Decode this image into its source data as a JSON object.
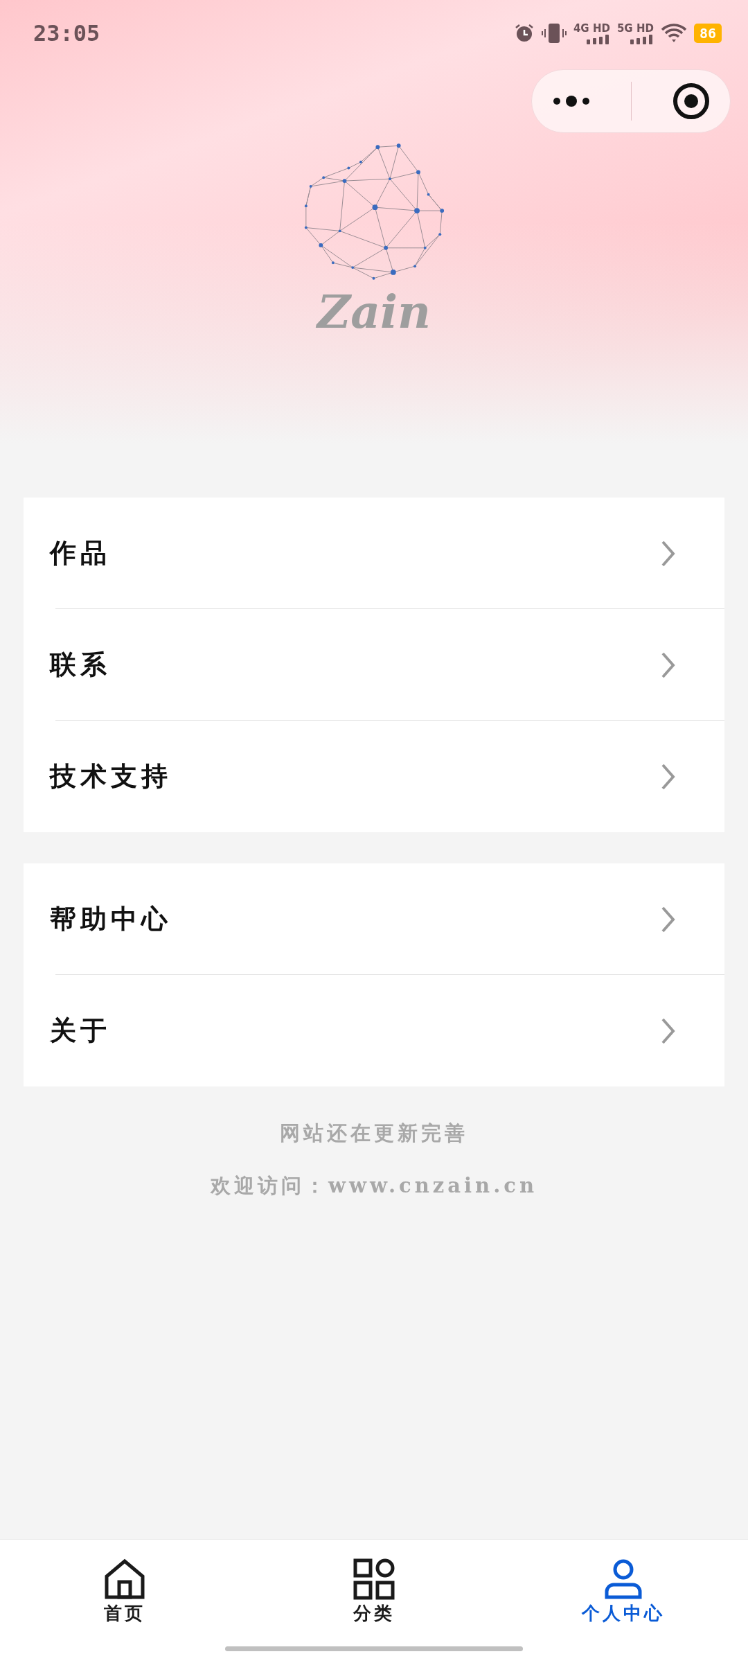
{
  "status_bar": {
    "time": "23:05",
    "network_1": "4G HD",
    "network_2": "5G HD",
    "battery": "86"
  },
  "logo": {
    "title": "Zain"
  },
  "menu_groups": [
    {
      "items": [
        {
          "label": "作品"
        },
        {
          "label": "联系"
        },
        {
          "label": "技术支持"
        }
      ]
    },
    {
      "items": [
        {
          "label": "帮助中心"
        },
        {
          "label": "关于"
        }
      ]
    }
  ],
  "footer": [
    "网站还在更新完善",
    "欢迎访问：www.cnzain.cn"
  ],
  "tab_bar": [
    {
      "label": "首页",
      "kind": "home",
      "selected": false
    },
    {
      "label": "分类",
      "kind": "grid",
      "selected": false
    },
    {
      "label": "个人中心",
      "kind": "person",
      "selected": true
    }
  ]
}
